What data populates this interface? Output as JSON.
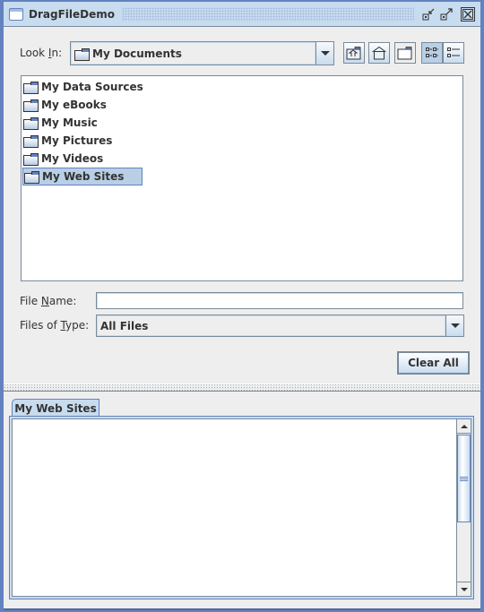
{
  "window": {
    "title": "DragFileDemo",
    "controls": [
      "iconify-icon",
      "maximize-icon",
      "close-icon"
    ]
  },
  "file_chooser": {
    "look_in_label": "Look ",
    "look_in_mnemonic": "I",
    "look_in_suffix": "n:",
    "look_in_value": "My Documents",
    "toolbar": [
      {
        "name": "up-one-level-button",
        "icon": "up-folder-icon",
        "tooltip": "Up One Level"
      },
      {
        "name": "home-button",
        "icon": "home-icon",
        "tooltip": "Home"
      },
      {
        "name": "new-folder-button",
        "icon": "new-folder-icon",
        "tooltip": "Create New Folder"
      },
      {
        "name": "list-view-button",
        "icon": "list-view-icon",
        "tooltip": "List",
        "selected": true
      },
      {
        "name": "details-view-button",
        "icon": "details-view-icon",
        "tooltip": "Details",
        "selected": false
      }
    ],
    "files": [
      {
        "label": "My Data Sources",
        "selected": false
      },
      {
        "label": "My eBooks",
        "selected": false
      },
      {
        "label": "My Music",
        "selected": false
      },
      {
        "label": "My Pictures",
        "selected": false
      },
      {
        "label": "My Videos",
        "selected": false
      },
      {
        "label": "My Web Sites",
        "selected": true
      }
    ],
    "file_name_label_pre": "File ",
    "file_name_mnemonic": "N",
    "file_name_label_post": "ame:",
    "file_name_value": "",
    "files_of_type_label_pre": "Files of ",
    "files_of_type_mnemonic": "T",
    "files_of_type_label_post": "ype:",
    "files_of_type_value": "All Files"
  },
  "clear_all_label": "Clear All",
  "tabs": [
    {
      "label": "My Web Sites",
      "selected": true
    }
  ],
  "tab_content_text": ""
}
